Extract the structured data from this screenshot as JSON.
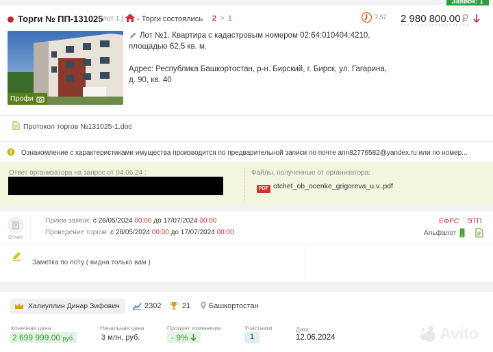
{
  "colors": {
    "accent_red": "#d62f2f",
    "green": "#3a9a3a",
    "yellow_bg": "#f3f5df",
    "badge_green": "#2e9e3e"
  },
  "bids_badge": "Заявок: 1",
  "header": {
    "title": "Торги № ПП-131025",
    "lot": "( лот 1 )",
    "status_prefix": "- Торги состоялись",
    "count_red": "2",
    "count_sep": ">",
    "count_green": "1",
    "rating": "7.57",
    "price": "2 980 800.00",
    "currency": "₽"
  },
  "lot": {
    "photo_badge": "Профи",
    "description": "Лот №1. Квартира с кадастровым номером 02:64:010404:4210, площадью 62,5 кв. м.",
    "address": "Адрес: Республика Башкортостан, р-н. Бирский, г. Бирск, ул. Гагарина, д. 90, кв. 40"
  },
  "protocol": "Протокол торгов №131025-1.doc",
  "notice": "Ознакомление с характеристиками имущества производится по предварительной записи по почте ann82776582@yandex.ru или по номер...",
  "organizer": {
    "answer_label": "Ответ организатора на запрос от 04.06.24 :",
    "files_label": "Файлы, полученные от организатора:",
    "file_type": "PDF",
    "file_name": "otchet_ob_ocenke_grigoreva_u.v..pdf"
  },
  "schedule": {
    "report_label": "Отчет",
    "app_label": "Прием заявок:",
    "app_from_pre": "с",
    "app_from_date": "28/05/2024",
    "app_from_time": "00:00",
    "app_to_pre": "до",
    "app_to_date": "17/07/2024",
    "app_to_time": "00:00",
    "auction_label": "Проведение торгов:",
    "auc_from_pre": "с",
    "auc_from_date": "28/05/2024",
    "auc_from_time": "00:00",
    "auc_to_pre": "до",
    "auc_to_date": "17/07/2024",
    "auc_to_time": "00:00",
    "efrs": "ЕФРС",
    "etp": "ЭТП",
    "alfalot": "Альфалот"
  },
  "note": {
    "placeholder": "Заметка по лоту ( видна только вам )"
  },
  "winner": {
    "name": "Халиуллин  Динар  Зифович",
    "stat_value": "2302",
    "wins_value": "21",
    "region": "Башкортостан"
  },
  "results": {
    "final_label": "Конечная цена",
    "final_value": "2 699 999.00",
    "final_unit": "руб.",
    "start_label": "Начальная цена",
    "start_value": "3 млн. руб.",
    "change_label": "Процент изменения",
    "change_value": "- 9%",
    "participants_label": "Участники",
    "participants_value": "1",
    "date_label": "Дата",
    "date_value": "12.06.2024"
  },
  "watermark": "Avito"
}
